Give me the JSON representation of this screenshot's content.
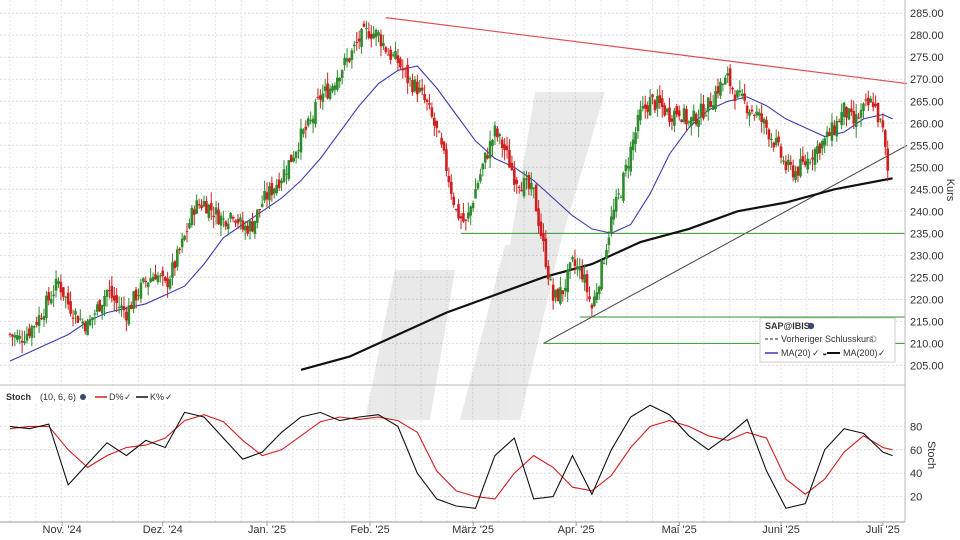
{
  "chart_data": [
    {
      "type": "candlestick",
      "ylabel": "Kurs",
      "ylim": [
        201,
        288
      ],
      "yticks": [
        205,
        210,
        215,
        220,
        225,
        230,
        235,
        240,
        245,
        250,
        255,
        260,
        265,
        270,
        275,
        280,
        285
      ],
      "ytick_labels": [
        "205.00",
        "210.00",
        "215.00",
        "220.00",
        "225.00",
        "230.00",
        "235.00",
        "240.00",
        "245.00",
        "250.00",
        "255.00",
        "260.00",
        "265.00",
        "270.00",
        "275.00",
        "280.00",
        "285.00"
      ],
      "x_months": [
        "Nov. '24",
        "Dez. '24",
        "Jan. '25",
        "Feb. '25",
        "März '25",
        "Apr. '25",
        "Mai '25",
        "Juni '25",
        "Juli '25"
      ],
      "grid": true,
      "colors": {
        "up": "#2e8b2e",
        "down": "#d11f1f",
        "ma20": "#3b3bb4",
        "ma200": "#111111",
        "resistance": "#e05050",
        "support": "#2f9a2f",
        "trend": "#444444"
      },
      "legend": {
        "symbol": "SAP@IBIS",
        "items": [
          {
            "label": "Vorheriger Schlusskurs"
          },
          {
            "label": "MA(20)"
          },
          {
            "label": "MA(200)"
          }
        ]
      },
      "price_path": [
        [
          0,
          212
        ],
        [
          4,
          211
        ],
        [
          8,
          213
        ],
        [
          12,
          216
        ],
        [
          16,
          220
        ],
        [
          20,
          224
        ],
        [
          24,
          219
        ],
        [
          28,
          216
        ],
        [
          32,
          214
        ],
        [
          36,
          218
        ],
        [
          40,
          222
        ],
        [
          44,
          219
        ],
        [
          48,
          217
        ],
        [
          52,
          221
        ],
        [
          56,
          224
        ],
        [
          60,
          226
        ],
        [
          64,
          223
        ],
        [
          68,
          228
        ],
        [
          72,
          234
        ],
        [
          76,
          241
        ],
        [
          80,
          242
        ],
        [
          84,
          240
        ],
        [
          88,
          238
        ],
        [
          92,
          240
        ],
        [
          96,
          236
        ],
        [
          100,
          237
        ],
        [
          104,
          242
        ],
        [
          108,
          245
        ],
        [
          112,
          248
        ],
        [
          116,
          252
        ],
        [
          120,
          257
        ],
        [
          124,
          260
        ],
        [
          128,
          266
        ],
        [
          132,
          268
        ],
        [
          136,
          272
        ],
        [
          140,
          275
        ],
        [
          144,
          279
        ],
        [
          148,
          281
        ],
        [
          152,
          280
        ],
        [
          156,
          276
        ],
        [
          160,
          274
        ],
        [
          164,
          270
        ],
        [
          168,
          268
        ],
        [
          172,
          264
        ],
        [
          176,
          258
        ],
        [
          180,
          250
        ],
        [
          184,
          240
        ],
        [
          188,
          237
        ],
        [
          192,
          245
        ],
        [
          196,
          252
        ],
        [
          200,
          258
        ],
        [
          204,
          254
        ],
        [
          208,
          248
        ],
        [
          212,
          246
        ],
        [
          216,
          244
        ],
        [
          220,
          232
        ],
        [
          224,
          220
        ],
        [
          228,
          222
        ],
        [
          232,
          228
        ],
        [
          236,
          226
        ],
        [
          240,
          218
        ],
        [
          244,
          227
        ],
        [
          248,
          238
        ],
        [
          252,
          245
        ],
        [
          256,
          254
        ],
        [
          260,
          262
        ],
        [
          264,
          265
        ],
        [
          268,
          264
        ],
        [
          272,
          262
        ],
        [
          276,
          263
        ],
        [
          280,
          260
        ],
        [
          284,
          262
        ],
        [
          288,
          264
        ],
        [
          292,
          268
        ],
        [
          296,
          270
        ],
        [
          300,
          266
        ],
        [
          304,
          264
        ],
        [
          308,
          262
        ],
        [
          312,
          259
        ],
        [
          316,
          255
        ],
        [
          320,
          250
        ],
        [
          324,
          249
        ],
        [
          328,
          251
        ],
        [
          332,
          254
        ],
        [
          336,
          256
        ],
        [
          340,
          259
        ],
        [
          344,
          263
        ],
        [
          348,
          260
        ],
        [
          352,
          263
        ],
        [
          356,
          265
        ],
        [
          360,
          258
        ],
        [
          362,
          249
        ]
      ],
      "ma20_path": [
        [
          0,
          206
        ],
        [
          8,
          208
        ],
        [
          16,
          210
        ],
        [
          24,
          212
        ],
        [
          32,
          215
        ],
        [
          40,
          217
        ],
        [
          48,
          218
        ],
        [
          56,
          219
        ],
        [
          64,
          221
        ],
        [
          72,
          223
        ],
        [
          80,
          228
        ],
        [
          88,
          234
        ],
        [
          96,
          237
        ],
        [
          104,
          240
        ],
        [
          112,
          243
        ],
        [
          120,
          247
        ],
        [
          128,
          252
        ],
        [
          136,
          258
        ],
        [
          144,
          264
        ],
        [
          152,
          269
        ],
        [
          160,
          272
        ],
        [
          168,
          273
        ],
        [
          176,
          268
        ],
        [
          184,
          262
        ],
        [
          192,
          256
        ],
        [
          200,
          252
        ],
        [
          208,
          250
        ],
        [
          216,
          247
        ],
        [
          224,
          243
        ],
        [
          232,
          239
        ],
        [
          240,
          236
        ],
        [
          248,
          235
        ],
        [
          256,
          237
        ],
        [
          264,
          244
        ],
        [
          272,
          253
        ],
        [
          280,
          259
        ],
        [
          288,
          263
        ],
        [
          296,
          265
        ],
        [
          304,
          266
        ],
        [
          312,
          264
        ],
        [
          320,
          261
        ],
        [
          328,
          259
        ],
        [
          336,
          257
        ],
        [
          344,
          258
        ],
        [
          352,
          261
        ],
        [
          360,
          262
        ],
        [
          364,
          261
        ]
      ],
      "ma200_path": [
        [
          120,
          204
        ],
        [
          140,
          207
        ],
        [
          160,
          212
        ],
        [
          180,
          217
        ],
        [
          200,
          221
        ],
        [
          220,
          225
        ],
        [
          240,
          228
        ],
        [
          260,
          233
        ],
        [
          280,
          236
        ],
        [
          300,
          240
        ],
        [
          320,
          242
        ],
        [
          340,
          245
        ],
        [
          364,
          247.5
        ]
      ],
      "resistance_line": [
        [
          155,
          284
        ],
        [
          370,
          269
        ]
      ],
      "support_trend_line": [
        [
          220,
          210
        ],
        [
          370,
          255
        ]
      ],
      "horizontal_levels": [
        {
          "value": 235,
          "x_from": 186
        },
        {
          "value": 216,
          "x_from": 235
        },
        {
          "value": 210,
          "x_from": 220
        }
      ]
    },
    {
      "type": "line",
      "title": "Stoch",
      "params": "(10, 6, 6)",
      "ylim": [
        0,
        100
      ],
      "yticks": [
        20,
        40,
        60,
        80
      ],
      "series": [
        {
          "name": "D%",
          "color": "#d11f1f",
          "points": [
            [
              0,
              78
            ],
            [
              8,
              80
            ],
            [
              16,
              80
            ],
            [
              24,
              60
            ],
            [
              32,
              45
            ],
            [
              40,
              55
            ],
            [
              48,
              62
            ],
            [
              56,
              64
            ],
            [
              64,
              70
            ],
            [
              72,
              85
            ],
            [
              80,
              90
            ],
            [
              88,
              84
            ],
            [
              96,
              68
            ],
            [
              104,
              55
            ],
            [
              112,
              60
            ],
            [
              120,
              72
            ],
            [
              128,
              84
            ],
            [
              136,
              88
            ],
            [
              144,
              86
            ],
            [
              152,
              88
            ],
            [
              160,
              85
            ],
            [
              168,
              75
            ],
            [
              176,
              42
            ],
            [
              184,
              25
            ],
            [
              192,
              20
            ],
            [
              200,
              18
            ],
            [
              208,
              40
            ],
            [
              216,
              55
            ],
            [
              224,
              45
            ],
            [
              232,
              28
            ],
            [
              240,
              25
            ],
            [
              248,
              38
            ],
            [
              256,
              62
            ],
            [
              264,
              80
            ],
            [
              272,
              85
            ],
            [
              280,
              80
            ],
            [
              288,
              72
            ],
            [
              296,
              68
            ],
            [
              304,
              75
            ],
            [
              312,
              70
            ],
            [
              320,
              35
            ],
            [
              328,
              22
            ],
            [
              336,
              35
            ],
            [
              344,
              58
            ],
            [
              352,
              72
            ],
            [
              360,
              62
            ],
            [
              364,
              60
            ]
          ]
        },
        {
          "name": "K%",
          "color": "#111111",
          "points": [
            [
              0,
              80
            ],
            [
              8,
              78
            ],
            [
              16,
              82
            ],
            [
              24,
              30
            ],
            [
              32,
              48
            ],
            [
              40,
              66
            ],
            [
              48,
              55
            ],
            [
              56,
              68
            ],
            [
              64,
              62
            ],
            [
              72,
              92
            ],
            [
              80,
              88
            ],
            [
              88,
              70
            ],
            [
              96,
              52
            ],
            [
              104,
              58
            ],
            [
              112,
              75
            ],
            [
              120,
              88
            ],
            [
              128,
              92
            ],
            [
              136,
              85
            ],
            [
              144,
              88
            ],
            [
              152,
              90
            ],
            [
              160,
              80
            ],
            [
              168,
              40
            ],
            [
              176,
              18
            ],
            [
              184,
              12
            ],
            [
              192,
              10
            ],
            [
              200,
              55
            ],
            [
              208,
              70
            ],
            [
              216,
              18
            ],
            [
              224,
              20
            ],
            [
              232,
              55
            ],
            [
              240,
              22
            ],
            [
              248,
              60
            ],
            [
              256,
              88
            ],
            [
              264,
              98
            ],
            [
              272,
              90
            ],
            [
              280,
              72
            ],
            [
              288,
              60
            ],
            [
              296,
              72
            ],
            [
              304,
              86
            ],
            [
              312,
              42
            ],
            [
              320,
              10
            ],
            [
              328,
              14
            ],
            [
              336,
              60
            ],
            [
              344,
              78
            ],
            [
              352,
              74
            ],
            [
              360,
              58
            ],
            [
              364,
              55
            ]
          ]
        }
      ]
    }
  ]
}
